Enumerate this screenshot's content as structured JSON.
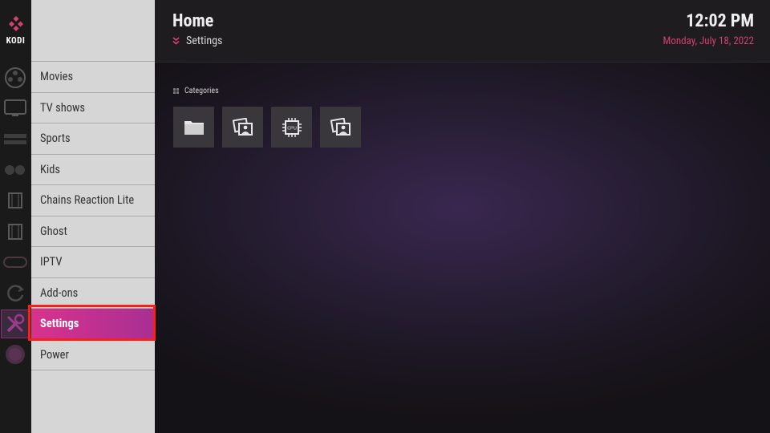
{
  "app": {
    "logo_text": "KODI"
  },
  "header": {
    "title": "Home",
    "subtitle": "Settings",
    "time": "12:02 PM",
    "date": "Monday, July 18, 2022"
  },
  "menu": {
    "items": [
      {
        "label": "Movies",
        "icon": "film-reel-icon"
      },
      {
        "label": "TV shows",
        "icon": "tv-icon"
      },
      {
        "label": "Sports",
        "icon": "sports-icon"
      },
      {
        "label": "Kids",
        "icon": "kids-icon"
      },
      {
        "label": "Chains Reaction Lite",
        "icon": "film-strip-icon"
      },
      {
        "label": "Ghost",
        "icon": "film-strip-icon"
      },
      {
        "label": "IPTV",
        "icon": "iptv-icon"
      },
      {
        "label": "Add-ons",
        "icon": "refresh-icon"
      },
      {
        "label": "Settings",
        "icon": "tools-icon",
        "active": true
      },
      {
        "label": "Power",
        "icon": "power-icon"
      }
    ],
    "active_color": "#d8328c"
  },
  "categories": {
    "label": "Categories",
    "tiles": [
      {
        "icon": "folder-icon"
      },
      {
        "icon": "photos-icon"
      },
      {
        "icon": "cpu-icon",
        "text": "CPU"
      },
      {
        "icon": "photos-icon"
      }
    ]
  },
  "colors": {
    "accent": "#d3416e",
    "highlight_border": "#ff1e14"
  }
}
